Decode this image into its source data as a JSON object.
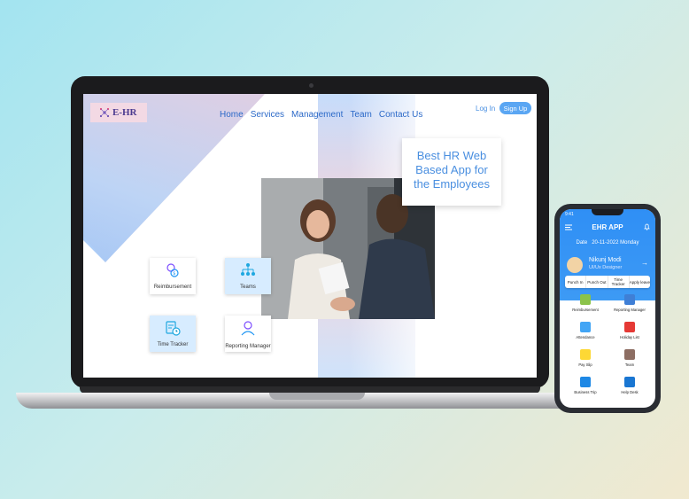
{
  "website": {
    "logo_text": "E-HR",
    "nav": [
      "Home",
      "Services",
      "Management",
      "Team",
      "Contact Us"
    ],
    "login": "Log In",
    "signup": "Sign Up",
    "hero_lines": [
      "Best HR Web",
      "Based App for",
      "the Employees"
    ],
    "tiles": [
      {
        "label": "Reimbursement",
        "icon": "money-bag-icon"
      },
      {
        "label": "Teams",
        "icon": "org-chart-icon"
      },
      {
        "label": "Time Tracker",
        "icon": "clipboard-clock-icon"
      },
      {
        "label": "Reporting Manager",
        "icon": "manager-icon"
      }
    ]
  },
  "phone": {
    "status_time": "9:41",
    "title": "EHR APP",
    "date_label": "Date",
    "date": "20-11-2022 Monday",
    "user_name": "Nikunj Modi",
    "user_role": "UI/Ux Designer",
    "actions": [
      "Punch In",
      "Punch Out",
      "Time Tracker",
      "Apply leave"
    ],
    "grid": [
      {
        "label": "Reimbursement",
        "color": "#8bc34a"
      },
      {
        "label": "Reporting Manager",
        "color": "#3f7fd6"
      },
      {
        "label": "Attendance",
        "color": "#42a5f5"
      },
      {
        "label": "Holiday List",
        "color": "#e53935"
      },
      {
        "label": "Pay Slip",
        "color": "#fdd835"
      },
      {
        "label": "Team",
        "color": "#8d6e63"
      },
      {
        "label": "Business Trip",
        "color": "#1e88e5"
      },
      {
        "label": "Help Desk",
        "color": "#1976d2"
      }
    ]
  },
  "colors": {
    "accent": "#2b69c8",
    "signup_bg": "#5aa6f3",
    "phone_header": "#2f8ff5"
  }
}
